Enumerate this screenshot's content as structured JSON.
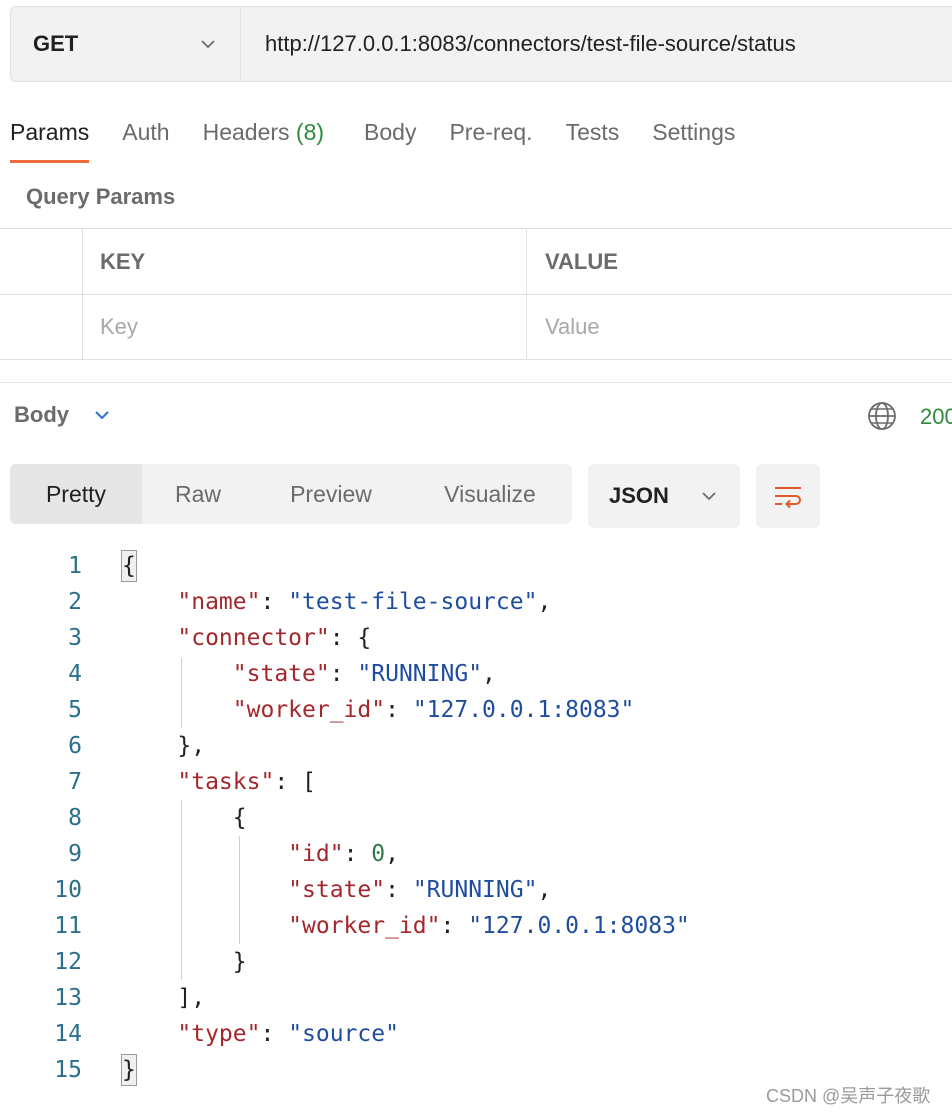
{
  "request": {
    "method": "GET",
    "url": "http://127.0.0.1:8083/connectors/test-file-source/status"
  },
  "tabs": [
    {
      "label": "Params",
      "active": true
    },
    {
      "label": "Auth"
    },
    {
      "label": "Headers",
      "count": "(8)"
    },
    {
      "label": "Body"
    },
    {
      "label": "Pre-req."
    },
    {
      "label": "Tests"
    },
    {
      "label": "Settings"
    }
  ],
  "query_params": {
    "title": "Query Params",
    "headers": {
      "key": "KEY",
      "value": "VALUE"
    },
    "placeholders": {
      "key": "Key",
      "value": "Value"
    }
  },
  "response": {
    "label": "Body",
    "status_code": "200",
    "view_tabs": [
      "Pretty",
      "Raw",
      "Preview",
      "Visualize"
    ],
    "active_view": "Pretty",
    "format": "JSON",
    "code_lines": [
      [
        {
          "t": "p",
          "v": "{"
        }
      ],
      [
        {
          "t": "p",
          "v": "    "
        },
        {
          "t": "k",
          "v": "\"name\""
        },
        {
          "t": "p",
          "v": ": "
        },
        {
          "t": "s",
          "v": "\"test-file-source\""
        },
        {
          "t": "p",
          "v": ","
        }
      ],
      [
        {
          "t": "p",
          "v": "    "
        },
        {
          "t": "k",
          "v": "\"connector\""
        },
        {
          "t": "p",
          "v": ": {"
        }
      ],
      [
        {
          "t": "p",
          "v": "        "
        },
        {
          "t": "k",
          "v": "\"state\""
        },
        {
          "t": "p",
          "v": ": "
        },
        {
          "t": "s",
          "v": "\"RUNNING\""
        },
        {
          "t": "p",
          "v": ","
        }
      ],
      [
        {
          "t": "p",
          "v": "        "
        },
        {
          "t": "k",
          "v": "\"worker_id\""
        },
        {
          "t": "p",
          "v": ": "
        },
        {
          "t": "s",
          "v": "\"127.0.0.1:8083\""
        }
      ],
      [
        {
          "t": "p",
          "v": "    },"
        }
      ],
      [
        {
          "t": "p",
          "v": "    "
        },
        {
          "t": "k",
          "v": "\"tasks\""
        },
        {
          "t": "p",
          "v": ": ["
        }
      ],
      [
        {
          "t": "p",
          "v": "        {"
        }
      ],
      [
        {
          "t": "p",
          "v": "            "
        },
        {
          "t": "k",
          "v": "\"id\""
        },
        {
          "t": "p",
          "v": ": "
        },
        {
          "t": "n",
          "v": "0"
        },
        {
          "t": "p",
          "v": ","
        }
      ],
      [
        {
          "t": "p",
          "v": "            "
        },
        {
          "t": "k",
          "v": "\"state\""
        },
        {
          "t": "p",
          "v": ": "
        },
        {
          "t": "s",
          "v": "\"RUNNING\""
        },
        {
          "t": "p",
          "v": ","
        }
      ],
      [
        {
          "t": "p",
          "v": "            "
        },
        {
          "t": "k",
          "v": "\"worker_id\""
        },
        {
          "t": "p",
          "v": ": "
        },
        {
          "t": "s",
          "v": "\"127.0.0.1:8083\""
        }
      ],
      [
        {
          "t": "p",
          "v": "        }"
        }
      ],
      [
        {
          "t": "p",
          "v": "    ],"
        }
      ],
      [
        {
          "t": "p",
          "v": "    "
        },
        {
          "t": "k",
          "v": "\"type\""
        },
        {
          "t": "p",
          "v": ": "
        },
        {
          "t": "s",
          "v": "\"source\""
        }
      ],
      [
        {
          "t": "p",
          "v": "}"
        }
      ]
    ]
  },
  "watermark": "CSDN @吴声子夜歌",
  "colors": {
    "accent": "#f26b3a",
    "success": "#2f8a3c",
    "json_key": "#a3282c",
    "json_string": "#1f4d9e",
    "json_number": "#2f7a4a"
  }
}
